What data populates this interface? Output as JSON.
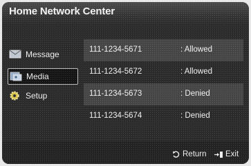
{
  "header": {
    "title": "Home Network Center"
  },
  "sidebar": {
    "items": [
      {
        "label": "Message",
        "icon": "envelope-icon"
      },
      {
        "label": "Media",
        "icon": "media-icon",
        "selected": true
      },
      {
        "label": "Setup",
        "icon": "gear-icon"
      }
    ]
  },
  "devices": {
    "rows": [
      {
        "number": "111-1234-5671",
        "status": ": Allowed"
      },
      {
        "number": "111-1234-5672",
        "status": ": Allowed"
      },
      {
        "number": "111-1234-5673",
        "status": ": Denied"
      },
      {
        "number": "111-1234-5674",
        "status": ": Denied"
      }
    ]
  },
  "footer": {
    "return_label": "Return",
    "exit_label": "Exit"
  }
}
